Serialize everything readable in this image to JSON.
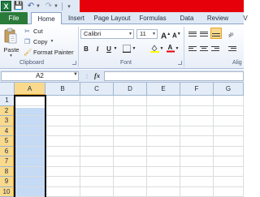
{
  "quick_access": {
    "app_icon": "excel-logo-icon",
    "app_letter": "X",
    "save_icon": "save-icon",
    "undo_icon": "undo-icon",
    "redo_icon": "redo-icon"
  },
  "tabs": [
    {
      "label": "File"
    },
    {
      "label": "Home"
    },
    {
      "label": "Insert"
    },
    {
      "label": "Page Layout"
    },
    {
      "label": "Formulas"
    },
    {
      "label": "Data"
    },
    {
      "label": "Review"
    },
    {
      "label": "V"
    }
  ],
  "ribbon": {
    "clipboard": {
      "paste_label": "Paste",
      "cut_label": "Cut",
      "copy_label": "Copy",
      "format_painter_label": "Format Painter",
      "group_label": "Clipboard"
    },
    "font": {
      "font_name": "Calibri",
      "font_size": "11",
      "grow_label": "A",
      "shrink_label": "A",
      "bold_label": "B",
      "italic_label": "I",
      "underline_label": "U",
      "group_label": "Font"
    },
    "alignment": {
      "group_label": "Alig"
    }
  },
  "formula_bar": {
    "name_box": "A2",
    "fx_label": "fx",
    "formula_value": ""
  },
  "grid": {
    "columns": [
      "A",
      "B",
      "C",
      "D",
      "E",
      "F",
      "G"
    ],
    "rows": [
      "1",
      "2",
      "3",
      "4",
      "5",
      "6",
      "7",
      "8",
      "9",
      "10"
    ],
    "active_column": "A",
    "selected_range": "A2:A10"
  },
  "colors": {
    "file_tab": "#2a7a3a",
    "title_bar": "#e6000a",
    "selection": "#c5daf5",
    "header_highlight": "#f9d98c"
  }
}
